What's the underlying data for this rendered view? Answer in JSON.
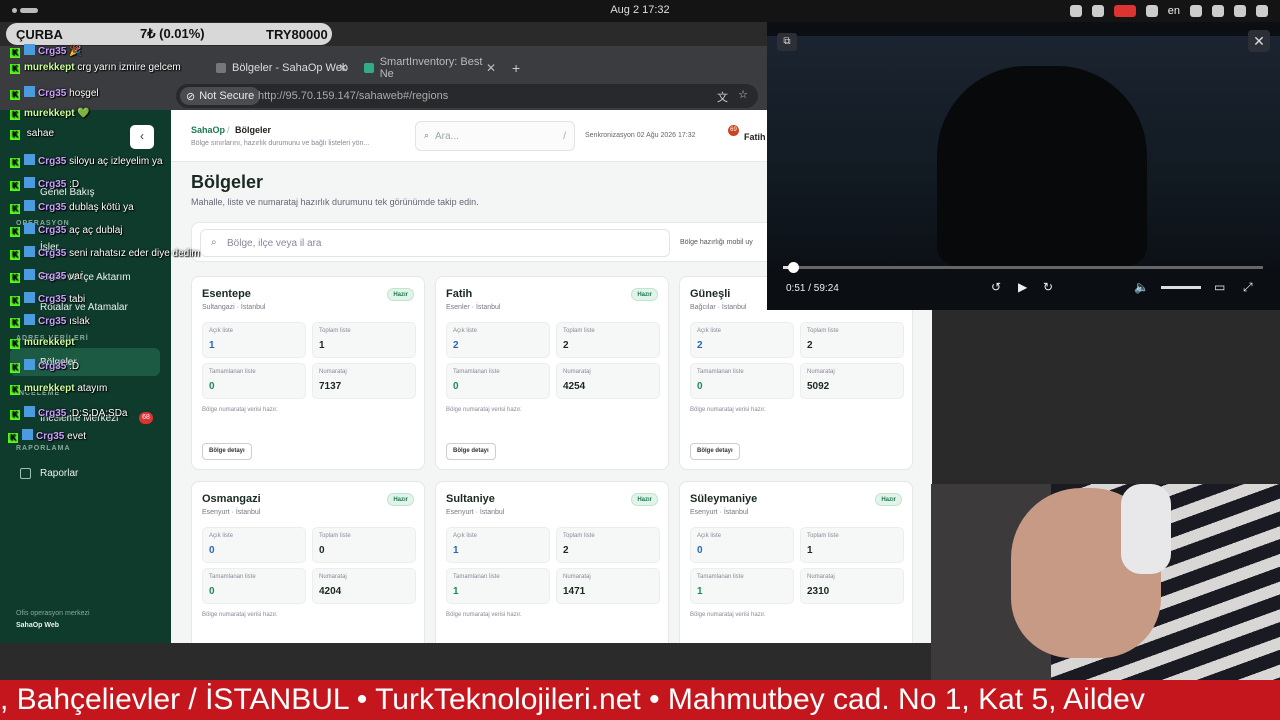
{
  "topbar": {
    "date": "Aug 2  17:32",
    "lang": "en"
  },
  "ticker": {
    "name": "ÇURBA",
    "change": "7₺ (0.01%)",
    "amount": "TRY80000"
  },
  "browser": {
    "tabs": [
      {
        "label": "Bölgeler - SahaOp Web"
      },
      {
        "label": "SmartInventory: Best Ne"
      }
    ],
    "not_secure": "Not Secure",
    "url": "http://95.70.159.147/sahaweb#/regions"
  },
  "app": {
    "sidebar": {
      "sections": [
        "Genel Bakış",
        "OPERASYON",
        "İşler",
        "Excel ve İçe Aktarım",
        "Rotalar ve Atamalar",
        "ADRES VERİLERİ",
        "Bölgeler",
        "İNCELEME",
        "İnceleme Merkezi",
        "RAPORLAMA",
        "Raporlar"
      ],
      "badge": "68",
      "footer_line1": "Ofis operasyon merkezi",
      "footer_line2": "SahaOp Web"
    },
    "header": {
      "crumb_root": "SahaOp",
      "crumb_sep": "/",
      "crumb_current": "Bölgeler",
      "crumb_desc": "Bölge sınırlarını, hazırlık durumunu ve bağlı listeleri yön...",
      "search_placeholder": "Ara...",
      "search_shortcut": "/",
      "sync": "Senkronizasyon 02 Ağu 2026 17:32",
      "notif_count": "69",
      "user": "Fatih"
    },
    "page_title": "Bölgeler",
    "page_subtitle": "Mahalle, liste ve numarataj hazırlık durumunu tek görünümde takip edin.",
    "filter_placeholder": "Bölge, ilçe veya il ara",
    "filter_chip": "Bölge hazırlığı mobil uy",
    "labels": {
      "open": "Açık liste",
      "total": "Toplam liste",
      "done": "Tamamlanan liste",
      "num": "Numarataj",
      "note": "Bölge numarataj verisi hazır.",
      "button": "Bölge detayı",
      "badge": "Hazır"
    },
    "regions": [
      {
        "name": "Esentepe",
        "loc": "Sultangazi · İstanbul",
        "open": "1",
        "total": "1",
        "done": "0",
        "num": "7137"
      },
      {
        "name": "Fatih",
        "loc": "Esenler · İstanbul",
        "open": "2",
        "total": "2",
        "done": "0",
        "num": "4254"
      },
      {
        "name": "Güneşli",
        "loc": "Bağcılar · İstanbul",
        "open": "2",
        "total": "2",
        "done": "0",
        "num": "5092"
      },
      {
        "name": "Osmangazi",
        "loc": "Esenyurt · İstanbul",
        "open": "0",
        "total": "0",
        "done": "0",
        "num": "4204"
      },
      {
        "name": "Sultaniye",
        "loc": "Esenyurt · İstanbul",
        "open": "1",
        "total": "2",
        "done": "1",
        "num": "1471"
      },
      {
        "name": "Süleymaniye",
        "loc": "Esenyurt · İstanbul",
        "open": "0",
        "total": "1",
        "done": "1",
        "num": "2310"
      }
    ]
  },
  "chat": [
    {
      "user": "Crg35",
      "msg": "🎉"
    },
    {
      "user": "murekkept",
      "msg": "crg yarın izmire gelcem"
    },
    {
      "user": "Crg35",
      "msg": "hoşgel"
    },
    {
      "user": "murekkept",
      "msg": "💚"
    },
    {
      "user": "",
      "msg": "sahae"
    },
    {
      "user": "Crg35",
      "msg": "siloyu aç izleyelim ya"
    },
    {
      "user": "Crg35",
      "msg": ":D"
    },
    {
      "user": "Crg35",
      "msg": "dublaş kötü ya"
    },
    {
      "user": "Crg35",
      "msg": "aç aç dublaj"
    },
    {
      "user": "Crg35",
      "msg": "seni rahatsız eder diye dedim"
    },
    {
      "user": "Crg35",
      "msg": "var"
    },
    {
      "user": "Crg35",
      "msg": "tabi"
    },
    {
      "user": "Crg35",
      "msg": "ıslak"
    },
    {
      "user": "murekkept",
      "msg": ""
    },
    {
      "user": "Crg35",
      "msg": ":D"
    },
    {
      "user": "murekkept",
      "msg": "atayım"
    },
    {
      "user": "Crg35",
      "msg": ":D:S:DA:SDa"
    },
    {
      "user": "Crg35",
      "msg": "evet"
    }
  ],
  "video": {
    "time": "0:51 / 59:24",
    "progress": 0.014
  },
  "banner": {
    "text": ", Bahçelievler / İSTANBUL • TurkTeknolojileri.net • Mahmutbey cad. No 1, Kat 5,  Aildev"
  }
}
